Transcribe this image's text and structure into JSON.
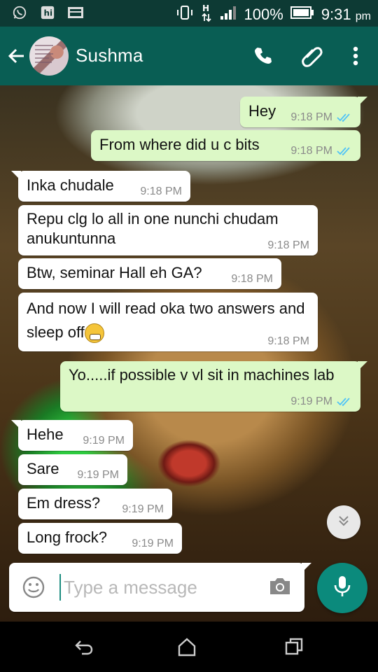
{
  "status_bar": {
    "battery": "100%",
    "time": "9:31",
    "ampm": "pm",
    "icons": [
      "whatsapp-icon",
      "hike-icon",
      "image-icon",
      "vibrate-icon",
      "data-h-icon",
      "signal-icon",
      "battery-icon"
    ]
  },
  "header": {
    "contact_name": "Sushma",
    "icons": [
      "back-arrow-icon",
      "phone-icon",
      "attachment-icon",
      "more-vert-icon"
    ]
  },
  "messages": [
    {
      "dir": "out",
      "text": "Hey",
      "time": "9:18 PM",
      "ticks": "read"
    },
    {
      "dir": "out",
      "text": "From where did u c bits",
      "time": "9:18 PM",
      "ticks": "read"
    },
    {
      "dir": "in",
      "text": "Inka chudale",
      "time": "9:18 PM"
    },
    {
      "dir": "in",
      "text": "Repu clg lo all in one nunchi chudam anukuntunna",
      "time": "9:18 PM"
    },
    {
      "dir": "in",
      "text": "Btw, seminar Hall eh GA?",
      "time": "9:18 PM"
    },
    {
      "dir": "in",
      "text": "And now I will read oka two answers and sleep off",
      "time": "9:18 PM",
      "emoji": "grimacing-face"
    },
    {
      "dir": "out",
      "text": "Yo.....if possible v vl sit in machines lab",
      "time": "9:19 PM",
      "ticks": "read"
    },
    {
      "dir": "in",
      "text": "Hehe",
      "time": "9:19 PM"
    },
    {
      "dir": "in",
      "text": "Sare",
      "time": "9:19 PM"
    },
    {
      "dir": "in",
      "text": "Em dress?",
      "time": "9:19 PM"
    },
    {
      "dir": "in",
      "text": "Long frock?",
      "time": "9:19 PM"
    }
  ],
  "composer": {
    "placeholder": "Type a message",
    "value": ""
  },
  "colors": {
    "header": "#095e54",
    "status_bar": "#0d3a34",
    "outgoing_bubble": "#dcf8c6",
    "incoming_bubble": "#ffffff",
    "read_ticks": "#4fc3f7",
    "mic_button": "#0b8a7c"
  }
}
